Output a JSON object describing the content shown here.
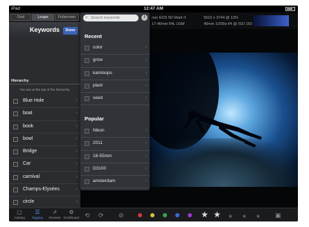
{
  "status_bar": {
    "carrier": "iPad",
    "time": "12:47 AM"
  },
  "view_segments": [
    "Grid",
    "Loupe",
    "Fullscreen"
  ],
  "keywords_panel": {
    "title": "Keywords",
    "done_label": "Done",
    "hierarchy_label": "Hierarchy",
    "top_note": "You are at the top of the hierarchy",
    "items": [
      "Blue Hole",
      "boat",
      "book",
      "bowl",
      "Bridge",
      "Car",
      "carnival",
      "Champs-Elysées",
      "circle"
    ]
  },
  "photo_info": {
    "camera": "non EOS 5D Mark II",
    "lens": "17-40mm f/4L USM",
    "dimensions": "5616 x 3744 @ 13%",
    "exposure": "40mm 1/200s f/4 @ ISO 160"
  },
  "keyword_popover": {
    "search_placeholder": "Search keywords",
    "recent_header": "Recent",
    "recent_items": [
      "color",
      "grow",
      "kamloops",
      "plant",
      "seed"
    ],
    "popular_header": "Popular",
    "popular_items": [
      "Nikon",
      "2011",
      "18-55mm",
      "D3100",
      "amsterdam"
    ]
  },
  "bottom_tabs": [
    {
      "label": "Catalog",
      "icon": "catalog-icon"
    },
    {
      "label": "Tagging",
      "icon": "tagging-icon"
    },
    {
      "label": "Reviews",
      "icon": "reviews-icon"
    },
    {
      "label": "Dashboard",
      "icon": "dashboard-icon"
    }
  ],
  "colors": {
    "accent": "#3d64b8",
    "label_red": "#d23a3a",
    "label_yellow": "#d8c23a",
    "label_green": "#3aa84a",
    "label_blue": "#3a6ad8",
    "label_purple": "#9a3ad0"
  },
  "rating": {
    "stars_filled": 2,
    "stars_total": 5
  }
}
